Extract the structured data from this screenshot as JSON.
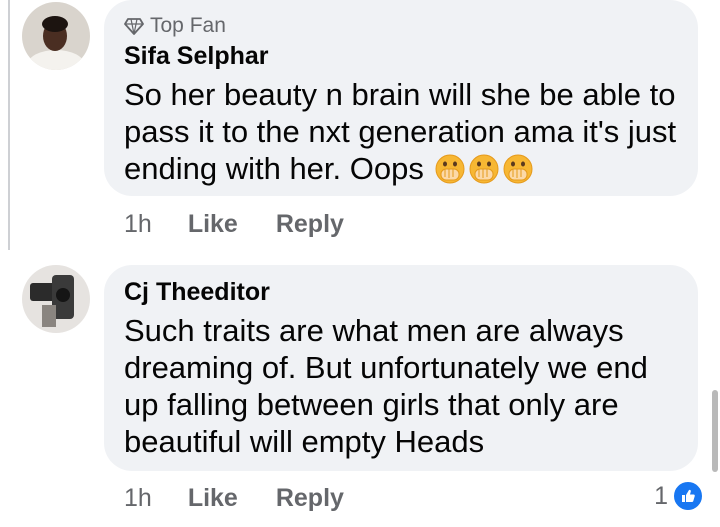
{
  "comments": [
    {
      "badge": "Top Fan",
      "author": "Sifa Selphar",
      "lines": [
        "So her beauty n brain will she be able to",
        "pass it to the nxt generation ama it's just",
        "ending with her. Oops"
      ],
      "emoji": [
        "hand-over-mouth-emoji",
        "hand-over-mouth-emoji",
        "hand-over-mouth-emoji"
      ],
      "time": "1h",
      "like_label": "Like",
      "reply_label": "Reply"
    },
    {
      "author": "Cj Theeditor",
      "lines": [
        "Such traits are what men are always",
        "dreaming of. But unfortunately we end",
        "up falling between girls that only are",
        "beautiful will empty Heads"
      ],
      "time": "1h",
      "like_label": "Like",
      "reply_label": "Reply",
      "reaction_count": "1",
      "reaction_icon": "thumbs-up-icon"
    }
  ],
  "colors": {
    "bubble": "#f0f2f5",
    "secondary_text": "#65676b",
    "like_blue": "#1877f2"
  }
}
